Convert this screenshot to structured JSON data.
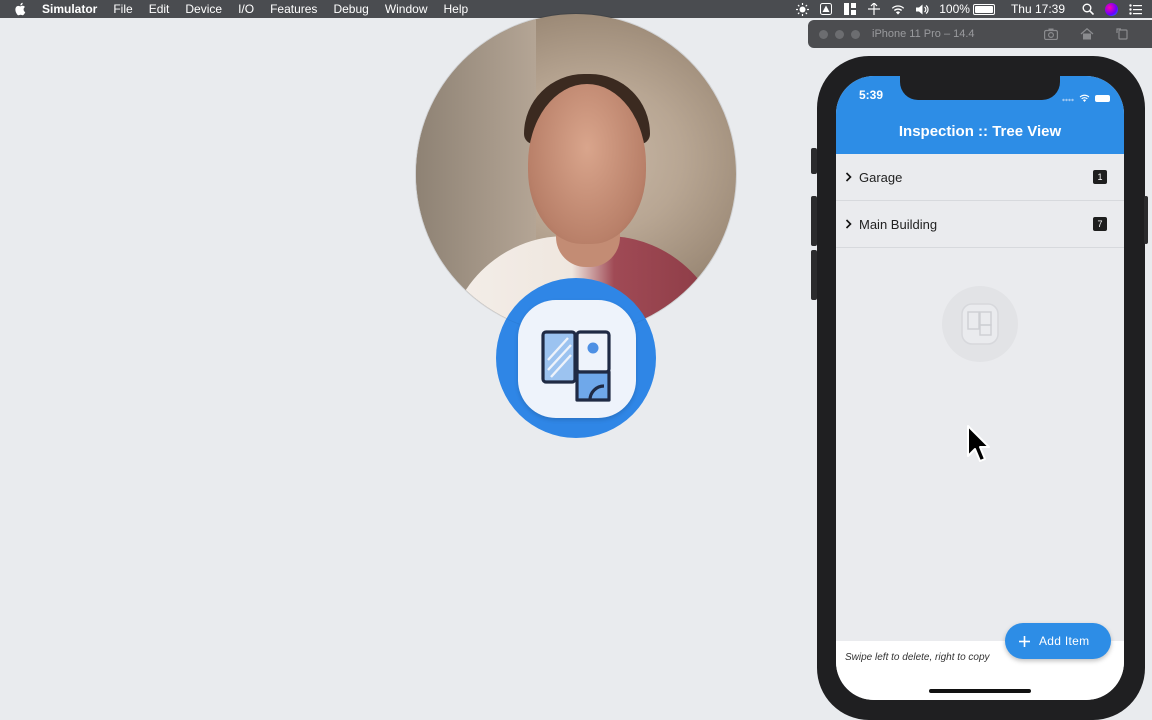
{
  "menubar": {
    "app_name": "Simulator",
    "items": [
      "File",
      "Edit",
      "Device",
      "I/O",
      "Features",
      "Debug",
      "Window",
      "Help"
    ],
    "battery": "100%",
    "clock": "Thu 17:39"
  },
  "simulator": {
    "window_title": "iPhone 11 Pro – 14.4"
  },
  "app": {
    "status_time": "5:39",
    "title": "Inspection :: Tree View",
    "rows": [
      {
        "label": "Garage",
        "count": "1"
      },
      {
        "label": "Main Building",
        "count": "7"
      }
    ],
    "hint": "Swipe left to delete, right to copy",
    "fab_label": "Add Item"
  },
  "colors": {
    "accent": "#2d8de6",
    "menubar": "#4a4c50",
    "background": "#e9ebee"
  }
}
